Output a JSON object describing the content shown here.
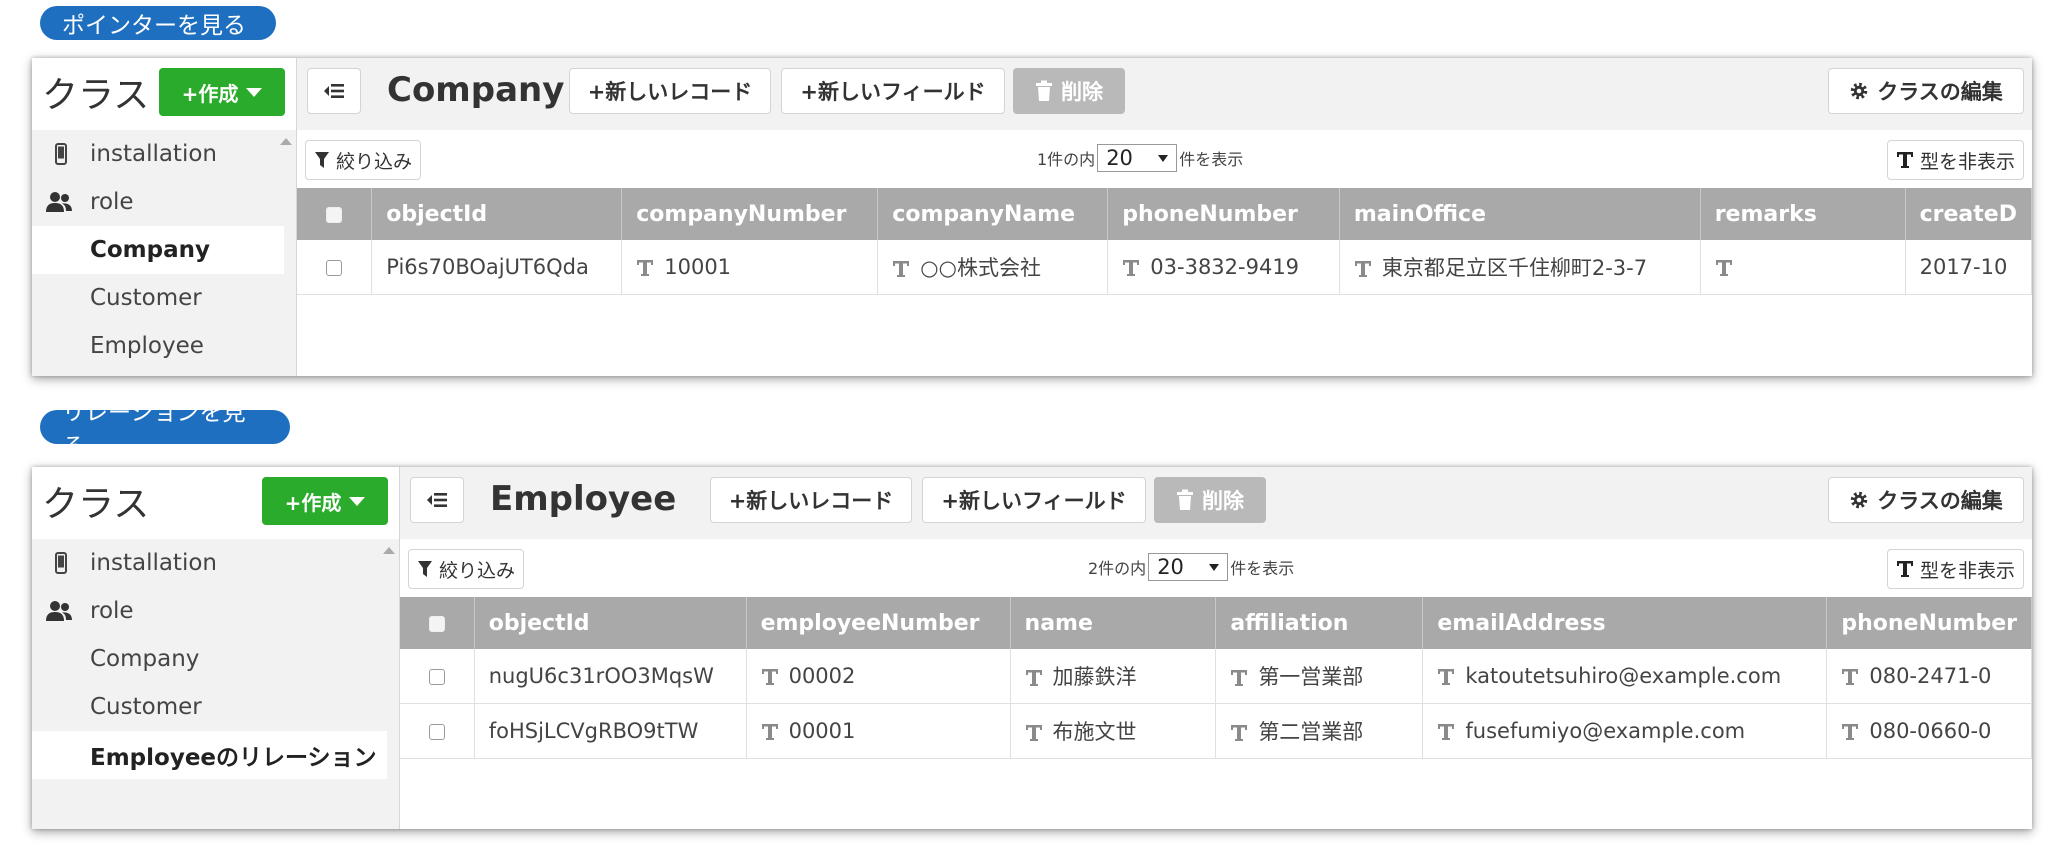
{
  "section1": {
    "label": "ポインターを見る",
    "sidebar": {
      "title": "クラス",
      "create_label": "+作成",
      "items": [
        {
          "label": "installation"
        },
        {
          "label": "role"
        },
        {
          "label": "Company"
        },
        {
          "label": "Customer"
        },
        {
          "label": "Employee"
        }
      ]
    },
    "toolbar": {
      "class_name": "Company",
      "new_record": "+新しいレコード",
      "new_field": "+新しいフィールド",
      "delete": "削除",
      "edit_class": "クラスの編集"
    },
    "filter": {
      "filter_label": "絞り込み",
      "count_prefix": "1件の内",
      "page_size": "20",
      "count_suffix": "件を表示",
      "hide_types": "型を非表示"
    },
    "table": {
      "columns": [
        "objectId",
        "companyNumber",
        "companyName",
        "phoneNumber",
        "mainOffice",
        "remarks",
        "createD"
      ],
      "rows": [
        [
          "Pi6s70BOajUT6Qda",
          "10001",
          "○○株式会社",
          "03-3832-9419",
          "東京都足立区千住柳町2-3-7",
          "",
          "2017-10"
        ]
      ]
    }
  },
  "section2": {
    "label": "リレーションを見る",
    "sidebar": {
      "title": "クラス",
      "create_label": "+作成",
      "items": [
        {
          "label": "installation"
        },
        {
          "label": "role"
        },
        {
          "label": "Company"
        },
        {
          "label": "Customer"
        },
        {
          "label": "Employeeのリレーション"
        }
      ]
    },
    "toolbar": {
      "class_name": "Employee",
      "new_record": "+新しいレコード",
      "new_field": "+新しいフィールド",
      "delete": "削除",
      "edit_class": "クラスの編集"
    },
    "filter": {
      "filter_label": "絞り込み",
      "count_prefix": "2件の内",
      "page_size": "20",
      "count_suffix": "件を表示",
      "hide_types": "型を非表示"
    },
    "table": {
      "columns": [
        "objectId",
        "employeeNumber",
        "name",
        "affiliation",
        "emailAddress",
        "phoneNumber"
      ],
      "rows": [
        [
          "nugU6c31rOO3MqsW",
          "00002",
          "加藤鉄洋",
          "第一営業部",
          "katoutetsuhiro@example.com",
          "080-2471-0"
        ],
        [
          "foHSjLCVgRBO9tTW",
          "00001",
          "布施文世",
          "第二営業部",
          "fusefumiyo@example.com",
          "080-0660-0"
        ]
      ]
    }
  },
  "colors": {
    "accent": "#1f6fc0",
    "create": "#2bab2b",
    "header": "#a9a9a9",
    "disabled": "#b9b9b9"
  }
}
